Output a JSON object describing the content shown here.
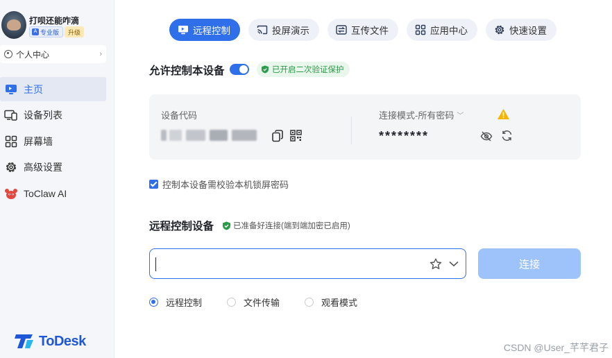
{
  "sidebar": {
    "profile": {
      "username": "打呗还能咋滴",
      "edition_badge": "专业版",
      "upgrade_badge": "升级"
    },
    "personal_center": "个人中心",
    "nav_items": [
      {
        "label": "主页",
        "icon": "monitor-icon",
        "active": true
      },
      {
        "label": "设备列表",
        "icon": "devices-icon",
        "active": false
      },
      {
        "label": "屏幕墙",
        "icon": "grid-icon",
        "active": false
      },
      {
        "label": "高级设置",
        "icon": "gear-icon",
        "active": false
      },
      {
        "label": "ToClaw AI",
        "icon": "crab-icon",
        "active": false
      }
    ],
    "logo_text": "ToDesk"
  },
  "tabs": [
    {
      "label": "远程控制",
      "icon": "monitor-icon",
      "active": true
    },
    {
      "label": "投屏演示",
      "icon": "cast-icon",
      "active": false
    },
    {
      "label": "互传文件",
      "icon": "transfer-icon",
      "active": false
    },
    {
      "label": "应用中心",
      "icon": "apps-icon",
      "active": false
    },
    {
      "label": "快速设置",
      "icon": "gear-icon",
      "active": false
    }
  ],
  "allow_control": {
    "title": "允许控制本设备",
    "enabled": true,
    "verify_status": "已开启二次验证保护"
  },
  "device_card": {
    "device_code_label": "设备代码",
    "connect_mode_label": "连接模式-所有密码",
    "password_masked": "********"
  },
  "lock_screen_check": {
    "label": "控制本设备需校验本机锁屏密码",
    "checked": true
  },
  "remote_control": {
    "title": "远程控制设备",
    "ready_status": "已准备好连接(端到端加密已启用)",
    "input_value": "",
    "connect_label": "连接",
    "modes": [
      {
        "label": "远程控制",
        "checked": true
      },
      {
        "label": "文件传输",
        "checked": false
      },
      {
        "label": "观看模式",
        "checked": false
      }
    ]
  },
  "watermark": "CSDN @User_芊芊君子",
  "colors": {
    "accent": "#2f6fea",
    "connect_disabled": "#9ec3fb",
    "success": "#2a9b48",
    "warning": "#f5b400",
    "sidebar_bg": "#f4f6f9"
  }
}
